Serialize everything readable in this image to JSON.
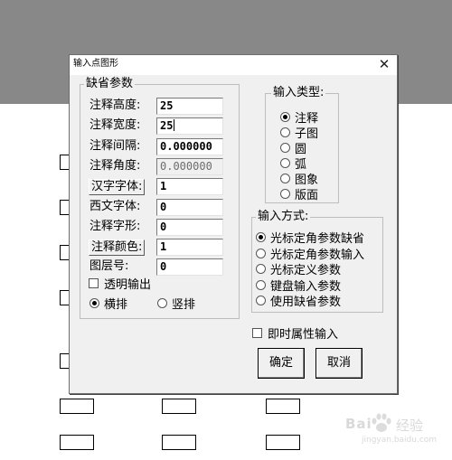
{
  "dialog": {
    "title": "输入点图形",
    "close_glyph": "✕"
  },
  "defaults_group": {
    "caption": "缺省参数",
    "fields": [
      {
        "label": "注释高度:",
        "value": "25",
        "is_button": false,
        "disabled": false
      },
      {
        "label": "注释宽度:",
        "value": "25",
        "is_button": false,
        "disabled": false,
        "focused": true
      },
      {
        "label": "注释间隔:",
        "value": "0.000000",
        "is_button": false,
        "disabled": false
      },
      {
        "label": "注释角度:",
        "value": "0.000000",
        "is_button": false,
        "disabled": true
      },
      {
        "label": "汉字字体:",
        "value": "1",
        "is_button": true,
        "disabled": false
      },
      {
        "label": "西文字体:",
        "value": "0",
        "is_button": false,
        "disabled": false
      },
      {
        "label": "注释字形:",
        "value": "0",
        "is_button": false,
        "disabled": false
      },
      {
        "label": "注释颜色:",
        "value": "1",
        "is_button": true,
        "disabled": false
      },
      {
        "label": "图层号:",
        "value": "0",
        "is_button": false,
        "disabled": false
      }
    ],
    "transparent_label": "透明输出",
    "transparent_checked": false,
    "orientation": [
      {
        "label": "横排",
        "selected": true
      },
      {
        "label": "竖排",
        "selected": false
      }
    ]
  },
  "input_type_group": {
    "caption": "输入类型:",
    "options": [
      {
        "label": "注释",
        "selected": true
      },
      {
        "label": "子图",
        "selected": false
      },
      {
        "label": "圆",
        "selected": false
      },
      {
        "label": "弧",
        "selected": false
      },
      {
        "label": "图象",
        "selected": false
      },
      {
        "label": "版面",
        "selected": false
      }
    ]
  },
  "input_method_group": {
    "caption": "输入方式:",
    "options": [
      {
        "label": "光标定角参数缺省",
        "selected": true
      },
      {
        "label": "光标定角参数输入",
        "selected": false
      },
      {
        "label": "光标定义参数",
        "selected": false
      },
      {
        "label": "键盘输入参数",
        "selected": false
      },
      {
        "label": "使用缺省参数",
        "selected": false
      }
    ]
  },
  "instant_attr": {
    "label": "即时属性输入",
    "checked": false
  },
  "buttons": {
    "ok_label": "确定",
    "cancel_label": "取消"
  },
  "watermark": {
    "brand": "Bai",
    "brand2": "经验",
    "url": "jingyan.baidu.com"
  }
}
